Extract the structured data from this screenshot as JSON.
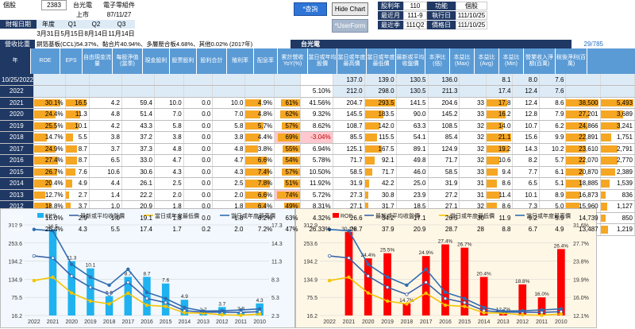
{
  "info": {
    "stock_label": "個股",
    "code": "2383",
    "name": "台光電",
    "industry": "電子零組件",
    "market": "上市",
    "list_date": "87/11/27",
    "fin_label": "財報日期",
    "year_label": "年度",
    "q1": "Q1",
    "q2": "Q2",
    "q3": "Q3",
    "d_year": "3月31日",
    "d_q1": "5月15日",
    "d_q2": "8月14日",
    "d_q3": "11月14日"
  },
  "buttons": {
    "query": "*查詢",
    "hide_chart": "Hide Chart",
    "userform": "*UserForm"
  },
  "right_info": {
    "r1a": "股利年",
    "r1b": "110",
    "r1c": "功能",
    "r1d": "個股",
    "r2a": "最近月",
    "r2b": "111-9",
    "r2c": "執行日",
    "r2d": "111/10/25",
    "r3a": "最近季",
    "r3b": "111Q2",
    "r3c": "價格日",
    "r3d": "111/10/25"
  },
  "banner": {
    "rev": "營收比重",
    "desc": "銅箔基板(CCL)54.37%、黏合片40.94%、多層壓合板4.68%、其他0.02% (2017年)",
    "name": "台光電",
    "rank": "29/785"
  },
  "headers": [
    "年",
    "ROE",
    "EPS",
    "自由現金流量",
    "每股淨值(當季)",
    "現金股利",
    "股票股利",
    "股利合計",
    "殖利率",
    "配息率",
    "累計營收YoY(%)",
    "當日或年均股價",
    "當日或年度最高價",
    "當日或年度最低價",
    "最新或平均收盤價",
    "本淨比(倍)",
    "本益比(Max)",
    "本益比(Avg)",
    "本益比(Min)",
    "營業收入淨額(百萬)",
    "稅後淨利(百萬)"
  ],
  "top_rows": [
    [
      "10/25/2022",
      "",
      "",
      "",
      "",
      "",
      "",
      "",
      "",
      "",
      "",
      "137.0",
      "139.0",
      "130.5",
      "136.0",
      "",
      "8.1",
      "8.0",
      "7.6",
      "",
      ""
    ],
    [
      "2022",
      "",
      "",
      "",
      "",
      "",
      "",
      "",
      "",
      "",
      "5.10%",
      "212.0",
      "298.0",
      "130.5",
      "211.3",
      "",
      "17.4",
      "12.4",
      "7.6",
      "",
      ""
    ]
  ],
  "rows": [
    [
      "2021",
      "30.1%",
      "16.5",
      "4.2",
      "59.4",
      "10.0",
      "0.0",
      "10.0",
      "4.9%",
      "61%",
      "41.56%",
      "204.7",
      "293.5",
      "141.5",
      "204.6",
      "33",
      "17.8",
      "12.4",
      "8.6",
      "38,500",
      "5,493"
    ],
    [
      "2020",
      "24.4%",
      "11.3",
      "4.8",
      "51.4",
      "7.0",
      "0.0",
      "7.0",
      "4.8%",
      "62%",
      "9.32%",
      "145.5",
      "183.5",
      "90.0",
      "145.2",
      "33",
      "16.2",
      "12.8",
      "7.9",
      "27,201",
      "3,689"
    ],
    [
      "2019",
      "25.5%",
      "10.1",
      "4.2",
      "43.3",
      "5.8",
      "0.0",
      "5.8",
      "5.7%",
      "57%",
      "8.62%",
      "108.7",
      "142.0",
      "63.3",
      "108.5",
      "32",
      "14.0",
      "10.7",
      "6.2",
      "24,866",
      "3,241"
    ],
    [
      "2018",
      "14.7%",
      "5.5",
      "3.8",
      "37.2",
      "3.8",
      "0.0",
      "3.8",
      "4.4%",
      "69%",
      "-3.04%",
      "85.5",
      "115.5",
      "54.1",
      "85.4",
      "32",
      "21.1",
      "15.6",
      "9.9",
      "22,891",
      "1,751"
    ],
    [
      "2017",
      "24.9%",
      "8.7",
      "3.7",
      "37.3",
      "4.8",
      "0.0",
      "4.8",
      "3.8%",
      "55%",
      "6.94%",
      "125.1",
      "167.5",
      "89.1",
      "124.9",
      "32",
      "19.2",
      "14.3",
      "10.2",
      "23,610",
      "2,791"
    ],
    [
      "2016",
      "27.4%",
      "8.7",
      "6.5",
      "33.0",
      "4.7",
      "0.0",
      "4.7",
      "6.6%",
      "54%",
      "5.78%",
      "71.7",
      "92.1",
      "49.8",
      "71.7",
      "32",
      "10.6",
      "8.2",
      "5.7",
      "22,070",
      "2,770"
    ],
    [
      "2015",
      "26.7%",
      "7.6",
      "10.6",
      "30.6",
      "4.3",
      "0.0",
      "4.3",
      "7.4%",
      "57%",
      "10.50%",
      "58.5",
      "71.7",
      "46.0",
      "58.5",
      "33",
      "9.4",
      "7.7",
      "6.1",
      "20,870",
      "2,389"
    ],
    [
      "2014",
      "20.4%",
      "4.9",
      "4.4",
      "26.1",
      "2.5",
      "0.0",
      "2.5",
      "7.8%",
      "51%",
      "11.92%",
      "31.9",
      "42.2",
      "25.0",
      "31.9",
      "31",
      "8.6",
      "6.5",
      "5.1",
      "18,885",
      "1,539"
    ],
    [
      "2013",
      "12.7%",
      "2.7",
      "1.4",
      "22.2",
      "2.0",
      "0.0",
      "2.0",
      "6.6%",
      "74%",
      "5.72%",
      "27.3",
      "30.8",
      "23.9",
      "27.2",
      "31",
      "11.4",
      "10.1",
      "8.9",
      "16,873",
      "836"
    ],
    [
      "2012",
      "18.8%",
      "3.7",
      "1.0",
      "20.9",
      "1.8",
      "0.0",
      "1.8",
      "6.4%",
      "49%",
      "8.31%",
      "27.1",
      "31.7",
      "18.5",
      "27.1",
      "32",
      "8.6",
      "7.3",
      "5.0",
      "15,960",
      "1,127"
    ],
    [
      "2011",
      "16.0%",
      "2.9",
      "1.0",
      "19.1",
      "1.8",
      "0.0",
      "1.8",
      "6.2%",
      "63%",
      "4.32%",
      "26.6",
      "34.2",
      "17.1",
      "26.5",
      "30",
      "11.9",
      "9.2",
      "5.9",
      "14,739",
      "850"
    ],
    [
      "2010",
      "26.4%",
      "4.3",
      "5.5",
      "17.4",
      "1.7",
      "0.2",
      "2.0",
      "7.2%",
      "47%",
      "26.33%",
      "28.7",
      "37.9",
      "20.9",
      "28.7",
      "28",
      "8.8",
      "6.7",
      "4.9",
      "13,487",
      "1,219"
    ]
  ],
  "colors": {
    "navy": "#1f3864",
    "header_blue": "#5b9bd5",
    "orange": "#f5a623",
    "eps_bar": "#1fb2f0",
    "roe_bar": "#ff0000",
    "avg_line": "#3a62a8",
    "low_line": "#f5c400",
    "high_line": "#2f6db0"
  },
  "chart_data": [
    {
      "type": "bar",
      "categories": [
        "2022",
        "2021",
        "2020",
        "2019",
        "2018",
        "2017",
        "2016",
        "2015",
        "2014",
        "2013",
        "2012",
        "2011",
        "2010"
      ],
      "series": [
        {
          "name": "EPS",
          "values": [
            null,
            16.5,
            11.3,
            10.1,
            5.5,
            8.7,
            8.7,
            7.6,
            4.9,
            2.7,
            3.7,
            2.9,
            4.3
          ]
        },
        {
          "name": "最新或平均收盤價",
          "values": [
            211.3,
            204.6,
            145.2,
            108.5,
            85.4,
            124.9,
            71.7,
            58.5,
            31.9,
            27.2,
            27.1,
            26.5,
            28.7
          ]
        },
        {
          "name": "當日或年度最低價",
          "values": [
            130.5,
            141.5,
            90.0,
            63.3,
            54.1,
            89.1,
            49.8,
            46.0,
            25.0,
            23.9,
            18.5,
            17.1,
            20.9
          ]
        },
        {
          "name": "當日或年度最高價",
          "values": [
            298.0,
            293.5,
            183.5,
            142.0,
            115.5,
            167.5,
            92.1,
            71.7,
            42.2,
            30.8,
            31.7,
            34.2,
            37.9
          ]
        }
      ],
      "yticks_left": [
        "312.9",
        "253.6",
        "194.2",
        "134.9",
        "75.5",
        "16.2"
      ],
      "yticks_right": [
        "17.3",
        "14.3",
        "11.3",
        "8.3",
        "5.3",
        "2.3"
      ],
      "ylim": [
        16.2,
        312.9
      ],
      "y2lim": [
        2.3,
        17.3
      ],
      "point_labels": [
        "16.5",
        "11.3",
        "10.1",
        "5.5",
        "8.7",
        "8.7",
        "7.6",
        "4.9",
        "2.7",
        "3.7",
        "2.9",
        "4.3"
      ]
    },
    {
      "type": "bar",
      "categories": [
        "2022",
        "2021",
        "2020",
        "2019",
        "2018",
        "2017",
        "2016",
        "2015",
        "2014",
        "2013",
        "2012",
        "2011",
        "2010"
      ],
      "series": [
        {
          "name": "ROE",
          "values": [
            null,
            30.1,
            24.4,
            25.5,
            14.7,
            24.9,
            27.4,
            26.7,
            20.4,
            12.7,
            18.8,
            16.0,
            26.4
          ]
        },
        {
          "name": "最新或平均收盤價",
          "values": [
            211.3,
            204.6,
            145.2,
            108.5,
            85.4,
            124.9,
            71.7,
            58.5,
            31.9,
            27.2,
            27.1,
            26.5,
            28.7
          ]
        },
        {
          "name": "當日或年度最低價",
          "values": [
            130.5,
            141.5,
            90.0,
            63.3,
            54.1,
            89.1,
            49.8,
            46.0,
            25.0,
            23.9,
            18.5,
            17.1,
            20.9
          ]
        },
        {
          "name": "當日或年度最高價",
          "values": [
            298.0,
            293.5,
            183.5,
            142.0,
            115.5,
            167.5,
            92.1,
            71.7,
            42.2,
            30.8,
            31.7,
            34.2,
            37.9
          ]
        }
      ],
      "yticks_left": [
        "312.9",
        "253.6",
        "194.2",
        "134.9",
        "75.5",
        "16.2"
      ],
      "yticks_right": [
        "31.6%",
        "27.7%",
        "23.8%",
        "19.9%",
        "16.0%",
        "12.1%"
      ],
      "ylim": [
        16.2,
        312.9
      ],
      "y2lim": [
        12.1,
        31.6
      ],
      "point_labels": [
        "30.1%",
        "24.4%",
        "25.5%",
        "14.7%",
        "24.9%",
        "27.4%",
        "26.7%",
        "20.4%",
        "12.7%",
        "18.8%",
        "16.0%",
        "26.4%"
      ]
    }
  ]
}
